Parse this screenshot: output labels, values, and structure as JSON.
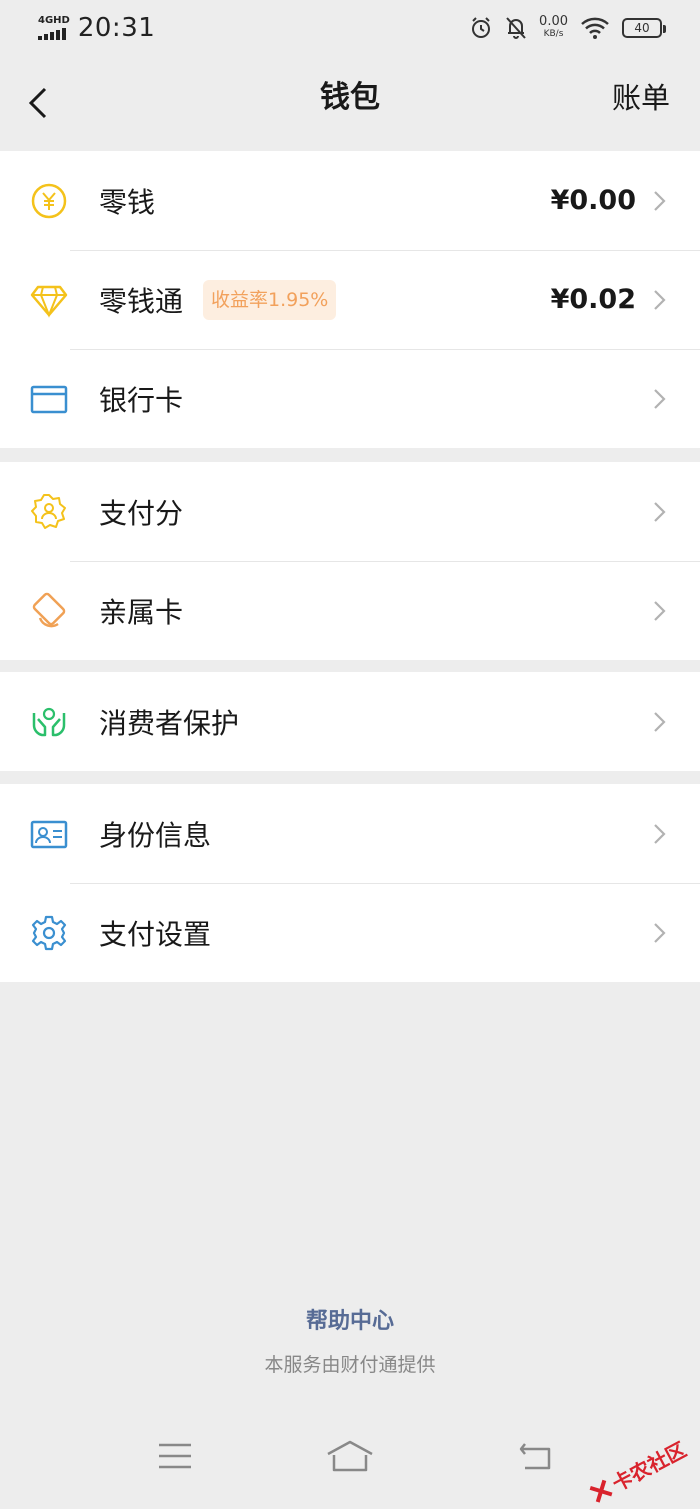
{
  "status_bar": {
    "network": "4GHD",
    "time": "20:31",
    "speed_value": "0.00",
    "speed_unit": "KB/s",
    "battery": "40"
  },
  "nav": {
    "title": "钱包",
    "right_action": "账单"
  },
  "groups": [
    {
      "items": [
        {
          "label": "零钱",
          "value": "¥0.00",
          "icon": "yuan-coin-icon"
        },
        {
          "label": "零钱通",
          "badge": "收益率1.95%",
          "value": "¥0.02",
          "icon": "diamond-icon"
        },
        {
          "label": "银行卡",
          "icon": "bank-card-icon"
        }
      ]
    },
    {
      "items": [
        {
          "label": "支付分",
          "icon": "payment-score-icon"
        },
        {
          "label": "亲属卡",
          "icon": "family-card-icon"
        }
      ]
    },
    {
      "items": [
        {
          "label": "消费者保护",
          "icon": "consumer-protection-icon"
        }
      ]
    },
    {
      "items": [
        {
          "label": "身份信息",
          "icon": "id-card-icon"
        },
        {
          "label": "支付设置",
          "icon": "gear-icon"
        }
      ]
    }
  ],
  "footer": {
    "help": "帮助中心",
    "note": "本服务由财付通提供"
  },
  "watermark": "卡农社区",
  "colors": {
    "background": "#ededed",
    "link": "#576b95",
    "badge_bg": "#fdeee0",
    "badge_text": "#f2a15c",
    "yellow_icon": "#f4c21b",
    "blue_icon": "#3a8fd0",
    "green_icon": "#2bbf6b",
    "orange_icon": "#f0a155"
  }
}
